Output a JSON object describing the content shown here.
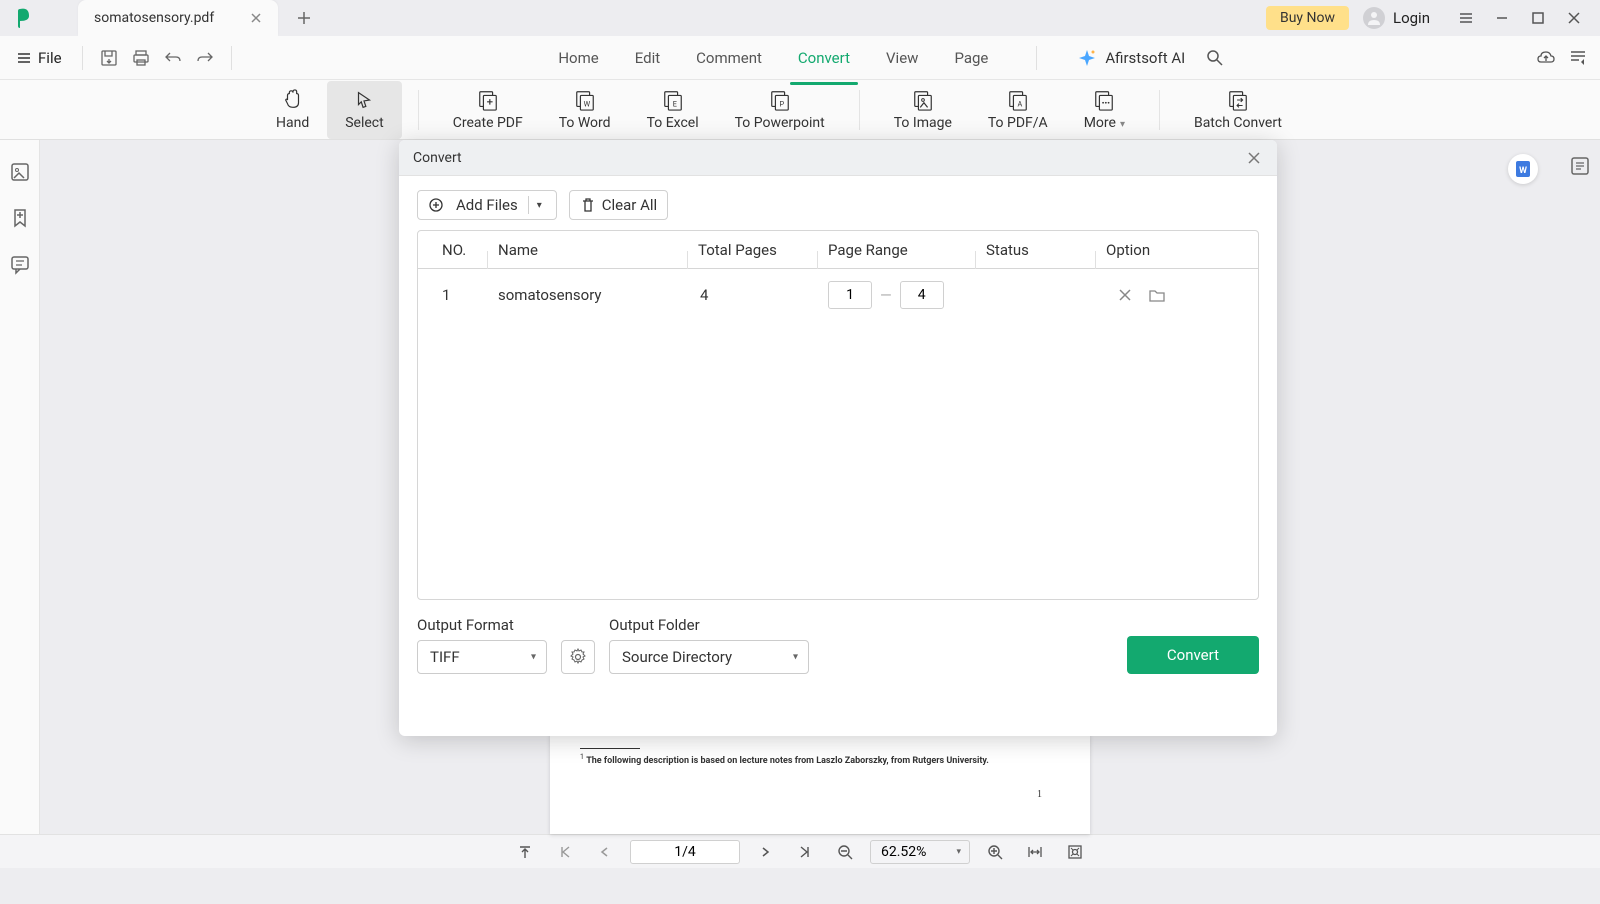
{
  "titlebar": {
    "tab_name": "somatosensory.pdf",
    "buy_now": "Buy Now",
    "login": "Login"
  },
  "menubar": {
    "file": "File",
    "items": [
      "Home",
      "Edit",
      "Comment",
      "Convert",
      "View",
      "Page"
    ],
    "ai_label": "Afirstsoft AI"
  },
  "toolbar": {
    "hand": "Hand",
    "select": "Select",
    "create_pdf": "Create PDF",
    "to_word": "To Word",
    "to_excel": "To Excel",
    "to_ppt": "To Powerpoint",
    "to_image": "To Image",
    "to_pdfa": "To PDF/A",
    "more": "More",
    "batch": "Batch Convert"
  },
  "dialog": {
    "title": "Convert",
    "add_files": "Add Files",
    "clear_all": "Clear All",
    "headers": {
      "no": "NO.",
      "name": "Name",
      "total": "Total Pages",
      "range": "Page Range",
      "status": "Status",
      "option": "Option"
    },
    "row": {
      "no": "1",
      "name": "somatosensory",
      "total": "4",
      "range_from": "1",
      "range_to": "4"
    },
    "output_format_label": "Output Format",
    "output_format_value": "TIFF",
    "output_folder_label": "Output Folder",
    "output_folder_value": "Source Directory",
    "convert_btn": "Convert"
  },
  "doc": {
    "footnote": "The following description is based on lecture notes from Laszlo Zaborszky, from Rutgers University.",
    "page_num": "1"
  },
  "statusbar": {
    "page_display": "1/4",
    "zoom": "62.52%"
  }
}
